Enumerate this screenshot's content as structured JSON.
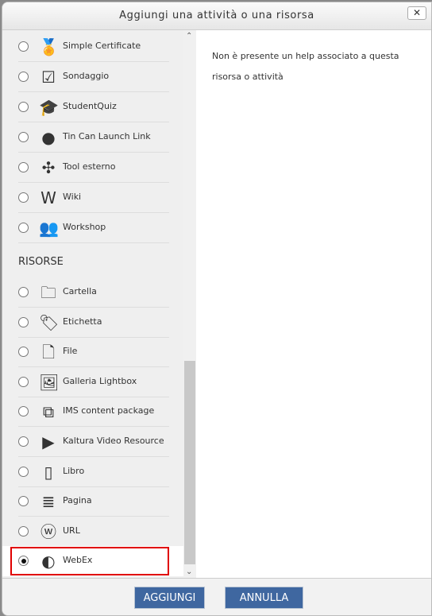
{
  "dialog": {
    "title": "Aggiungi una attività o una risorsa",
    "close_label": "✕"
  },
  "activities": [
    {
      "label": "Simple Certificate",
      "icon": "certificate-icon"
    },
    {
      "label": "Sondaggio",
      "icon": "survey-icon"
    },
    {
      "label": "StudentQuiz",
      "icon": "studentquiz-icon"
    },
    {
      "label": "Tin Can Launch Link",
      "icon": "tincan-icon"
    },
    {
      "label": "Tool esterno",
      "icon": "puzzle-icon"
    },
    {
      "label": "Wiki",
      "icon": "wiki-icon"
    },
    {
      "label": "Workshop",
      "icon": "workshop-icon"
    }
  ],
  "resources_heading": "RISORSE",
  "resources": [
    {
      "label": "Cartella",
      "icon": "folder-icon"
    },
    {
      "label": "Etichetta",
      "icon": "tag-icon"
    },
    {
      "label": "File",
      "icon": "file-icon"
    },
    {
      "label": "Galleria Lightbox",
      "icon": "gallery-icon"
    },
    {
      "label": "IMS content package",
      "icon": "package-icon"
    },
    {
      "label": "Kaltura Video Resource",
      "icon": "video-icon"
    },
    {
      "label": "Libro",
      "icon": "book-icon"
    },
    {
      "label": "Pagina",
      "icon": "page-icon"
    },
    {
      "label": "URL",
      "icon": "url-icon"
    },
    {
      "label": "WebEx",
      "icon": "webex-icon",
      "selected": true
    }
  ],
  "help_text": "Non è presente un help associato a questa risorsa o attività",
  "buttons": {
    "add": "AGGIUNGI",
    "cancel": "ANNULLA"
  },
  "colors": {
    "button": "#3f67a0",
    "selection_outline": "#e00000"
  }
}
